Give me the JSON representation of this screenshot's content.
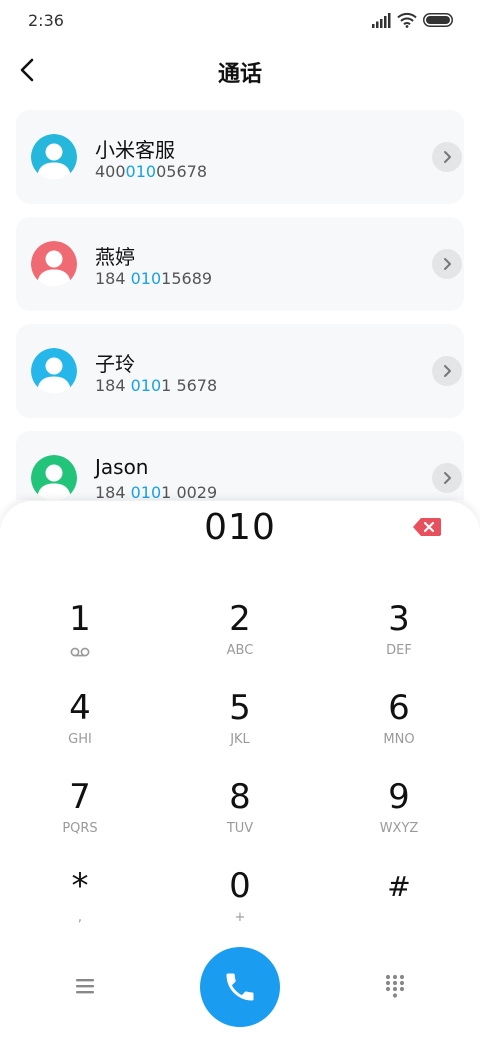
{
  "status_bar": {
    "time": "2:36"
  },
  "header": {
    "title": "通话"
  },
  "contacts": [
    {
      "name": "小米客服",
      "number": {
        "pre": "400",
        "match": "010",
        "post": "05678"
      },
      "avatar_color": "#25b7dc"
    },
    {
      "name": "燕婷",
      "number": {
        "pre": "184 ",
        "match": "010",
        "post": "15689"
      },
      "avatar_color": "#ef6a72"
    },
    {
      "name": "子玲",
      "number": {
        "pre": "184 ",
        "match": "010",
        "post": "1 5678"
      },
      "avatar_color": "#25b7ea"
    },
    {
      "name": "Jason",
      "number": {
        "pre": "184 ",
        "match": "010",
        "post": "1 0029"
      },
      "avatar_color": "#22c47a"
    }
  ],
  "dialpad": {
    "input": "010",
    "keys": [
      {
        "digit": "1",
        "letters": ""
      },
      {
        "digit": "2",
        "letters": "ABC"
      },
      {
        "digit": "3",
        "letters": "DEF"
      },
      {
        "digit": "4",
        "letters": "GHI"
      },
      {
        "digit": "5",
        "letters": "JKL"
      },
      {
        "digit": "6",
        "letters": "MNO"
      },
      {
        "digit": "7",
        "letters": "PQRS"
      },
      {
        "digit": "8",
        "letters": "TUV"
      },
      {
        "digit": "9",
        "letters": "WXYZ"
      },
      {
        "digit": "*",
        "letters": ","
      },
      {
        "digit": "0",
        "letters": "+"
      },
      {
        "digit": "#",
        "letters": ""
      }
    ]
  },
  "colors": {
    "highlight": "#1aa1e6",
    "call_button": "#1a9cf0",
    "delete_button": "#e8505b"
  },
  "icons": {
    "back": "chevron-left-icon",
    "delete": "backspace-icon",
    "voicemail": "voicemail-icon",
    "menu": "menu-icon",
    "call": "phone-icon",
    "keypad": "dialpad-grid-icon"
  }
}
